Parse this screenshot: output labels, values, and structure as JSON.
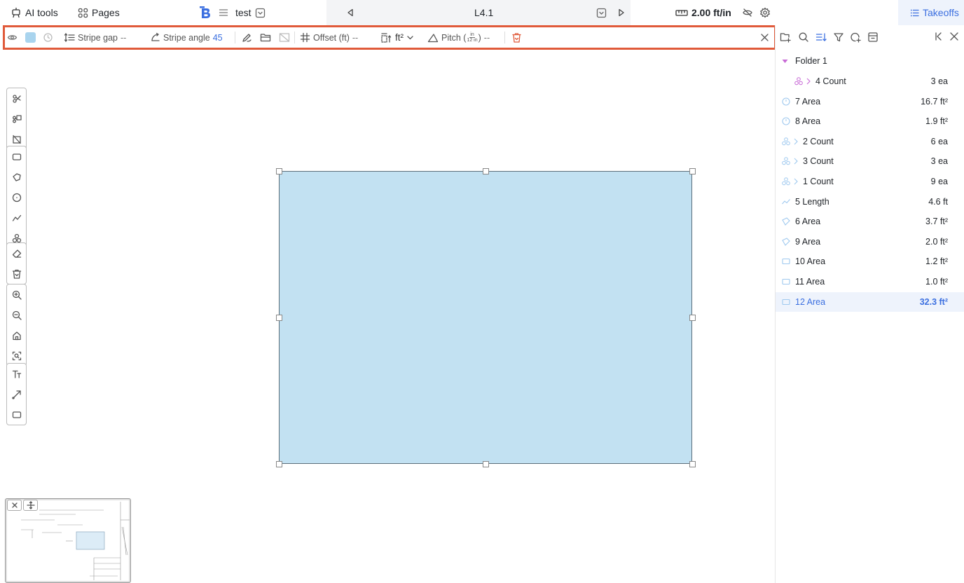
{
  "topbar": {
    "ai_tools_label": "AI tools",
    "pages_label": "Pages",
    "doc_name": "test",
    "page_name": "L4.1",
    "scale_label": "2.00 ft/in",
    "takeoffs_label": "Takeoffs"
  },
  "toolbar": {
    "stripe_gap_label": "Stripe gap",
    "stripe_gap_value": "--",
    "stripe_angle_label": "Stripe angle",
    "stripe_angle_value": "45",
    "offset_label": "Offset (ft)",
    "offset_value": "--",
    "unit_label": "ft²",
    "pitch_label": "Pitch (",
    "pitch_num": "in",
    "pitch_den": "12 in",
    "pitch_close": ")",
    "pitch_value": "--",
    "fill_color": "#a9d4ee",
    "delete_color": "#e05a3a",
    "highlight_color": "#e05a3a"
  },
  "takeoffs": {
    "folder": {
      "name": "Folder 1"
    },
    "items": [
      {
        "name": "4 Count",
        "value": "3 ea",
        "icon": "count-icon",
        "nested": true,
        "color": "#c86ad6"
      },
      {
        "name": "7 Area",
        "value": "16.7 ft²",
        "icon": "circle-area-icon",
        "nested": false,
        "color": "#9fc9ef"
      },
      {
        "name": "8 Area",
        "value": "1.9 ft²",
        "icon": "circle-area-icon",
        "nested": false,
        "color": "#9fc9ef"
      },
      {
        "name": "2 Count",
        "value": "6 ea",
        "icon": "count-icon",
        "nested": false,
        "color": "#9fc9ef"
      },
      {
        "name": "3 Count",
        "value": "3 ea",
        "icon": "count-icon",
        "nested": false,
        "color": "#9fc9ef"
      },
      {
        "name": "1 Count",
        "value": "9 ea",
        "icon": "count-icon",
        "nested": false,
        "color": "#9fc9ef"
      },
      {
        "name": "5 Length",
        "value": "4.6 ft",
        "icon": "length-icon",
        "nested": false,
        "color": "#9fc9ef"
      },
      {
        "name": "6 Area",
        "value": "3.7 ft²",
        "icon": "polygon-area-icon",
        "nested": false,
        "color": "#9fc9ef"
      },
      {
        "name": "9 Area",
        "value": "2.0 ft²",
        "icon": "polygon-area-icon",
        "nested": false,
        "color": "#9fc9ef"
      },
      {
        "name": "10 Area",
        "value": "1.2 ft²",
        "icon": "rect-area-icon",
        "nested": false,
        "color": "#9fc9ef"
      },
      {
        "name": "11 Area",
        "value": "1.0 ft²",
        "icon": "rect-area-icon",
        "nested": false,
        "color": "#9fc9ef"
      },
      {
        "name": "12 Area",
        "value": "32.3 ft²",
        "icon": "rect-area-icon",
        "nested": false,
        "selected": true,
        "color": "#9fc9ef"
      }
    ]
  },
  "canvas": {
    "shape_fill": "#c2e1f2"
  },
  "left_tools": [
    [
      "cut-icon",
      "cut-copy-icon",
      "exclude-icon"
    ],
    [
      "rectangle-tool-icon",
      "polygon-tool-icon",
      "circle-tool-icon",
      "polyline-tool-icon",
      "count-tool-icon"
    ],
    [
      "eraser-icon",
      "trash-icon"
    ],
    [
      "zoom-in-icon",
      "zoom-out-icon",
      "home-icon",
      "fit-view-icon"
    ],
    [
      "text-tool-icon",
      "arrow-tool-icon",
      "comment-box-icon"
    ]
  ]
}
